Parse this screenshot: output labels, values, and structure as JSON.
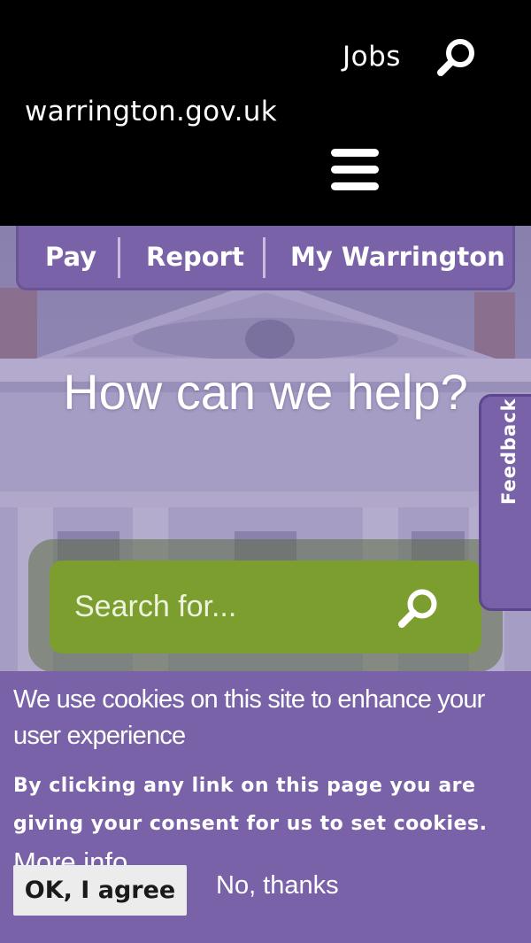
{
  "header": {
    "jobs_label": "Jobs",
    "brand": "warrington.gov.uk",
    "search_icon": "search-icon",
    "menu_icon": "hamburger-menu-icon",
    "background_color": "#000000"
  },
  "quick_links": {
    "items": [
      {
        "label": "Pay"
      },
      {
        "label": "Report"
      },
      {
        "label": "My Warrington"
      }
    ],
    "background_color": "#7a62a8"
  },
  "hero": {
    "title": "How can we help?"
  },
  "feedback": {
    "label": "Feedback"
  },
  "search": {
    "placeholder": "Search for...",
    "value": "",
    "button_icon": "search-icon",
    "accent_color": "#7b9e2e"
  },
  "cookie_banner": {
    "title": "We use cookies on this site to enhance your user experience",
    "consent_text": "By clicking any link on this page you are giving your consent for us to set cookies.",
    "more_info_label": "More info",
    "agree_label": "OK, I agree",
    "decline_label": "No, thanks",
    "background_color": "#7a62a8"
  }
}
